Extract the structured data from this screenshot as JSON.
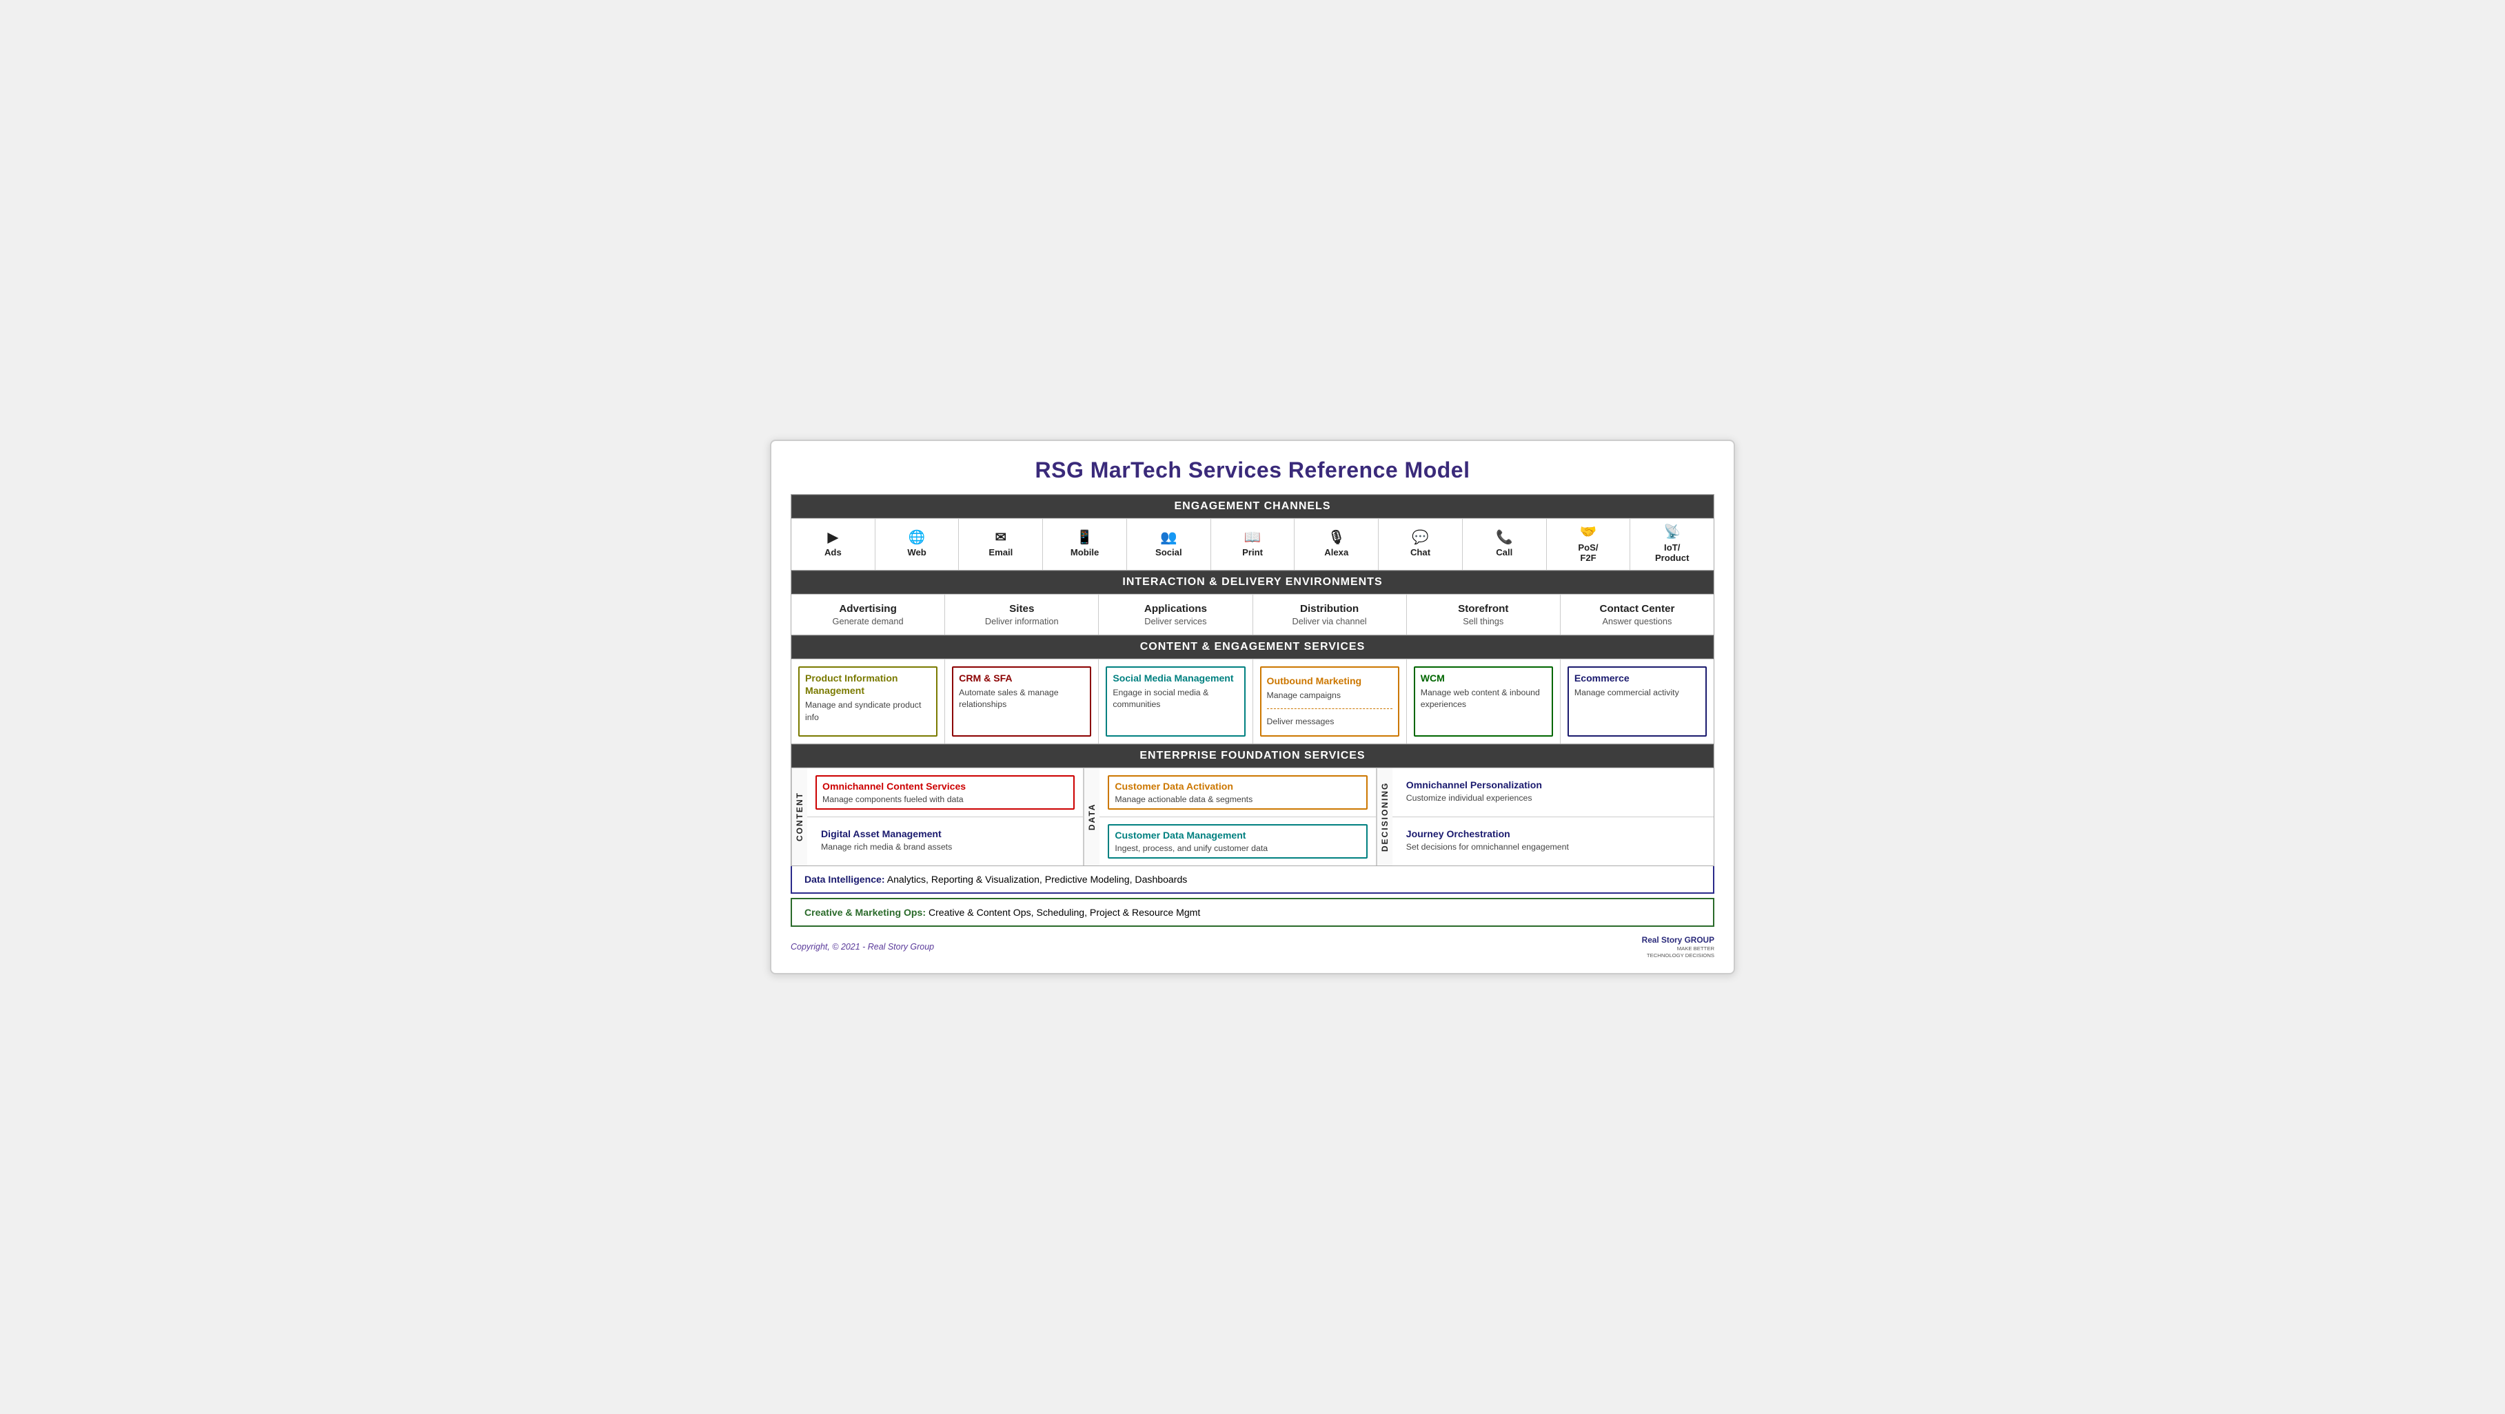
{
  "title": "RSG MarTech Services Reference Model",
  "sections": {
    "engagement_channels": {
      "header": "ENGAGEMENT CHANNELS",
      "channels": [
        {
          "icon": "▶",
          "label": "Ads"
        },
        {
          "icon": "🌐",
          "label": "Web"
        },
        {
          "icon": "✉",
          "label": "Email"
        },
        {
          "icon": "📱",
          "label": "Mobile"
        },
        {
          "icon": "👥",
          "label": "Social"
        },
        {
          "icon": "📖",
          "label": "Print"
        },
        {
          "icon": "🎙",
          "label": "Alexa"
        },
        {
          "icon": "💬",
          "label": "Chat"
        },
        {
          "icon": "📞",
          "label": "Call"
        },
        {
          "icon": "🤝",
          "label": "PoS/\nF2F"
        },
        {
          "icon": "📡",
          "label": "IoT/\nProduct"
        }
      ]
    },
    "interaction_delivery": {
      "header": "INTERACTION & DELIVERY ENVIRONMENTS",
      "cells": [
        {
          "title": "Advertising",
          "sub": "Generate demand"
        },
        {
          "title": "Sites",
          "sub": "Deliver information"
        },
        {
          "title": "Applications",
          "sub": "Deliver services"
        },
        {
          "title": "Distribution",
          "sub": "Deliver via channel"
        },
        {
          "title": "Storefront",
          "sub": "Sell things"
        },
        {
          "title": "Contact Center",
          "sub": "Answer questions"
        }
      ]
    },
    "content_engagement": {
      "header": "CONTENT & ENGAGEMENT SERVICES",
      "cells": [
        {
          "title": "Product Information Management",
          "sub": "Manage and syndicate product info",
          "color": "olive"
        },
        {
          "title": "CRM & SFA",
          "sub": "Automate sales & manage relationships",
          "color": "darkred"
        },
        {
          "title": "Social Media Management",
          "sub": "Engage in social media & communities",
          "color": "teal"
        },
        {
          "title": "Outbound Marketing",
          "sub_top": "Manage campaigns",
          "sub_bottom": "Deliver messages",
          "color": "orange",
          "split": true
        },
        {
          "title": "WCM",
          "sub": "Manage web content & inbound experiences",
          "color": "green"
        },
        {
          "title": "Ecommerce",
          "sub": "Manage commercial activity",
          "color": "navy"
        }
      ]
    },
    "enterprise_foundation": {
      "header": "ENTERPRISE FOUNDATION SERVICES",
      "content_label": "CONTENT",
      "data_label": "DATA",
      "decisioning_label": "DECISIONING",
      "content_cells": [
        {
          "title": "Omnichannel Content Services",
          "sub": "Manage components fueled with data",
          "color_class": "red",
          "title_color": "#cc0000"
        },
        {
          "title": "Digital Asset Management",
          "sub": "Manage rich media & brand assets",
          "color_class": "navy",
          "title_color": "#1a1a6e"
        }
      ],
      "data_cells": [
        {
          "title": "Customer Data Activation",
          "sub": "Manage actionable data & segments",
          "color_class": "orange",
          "title_color": "#cc7700"
        },
        {
          "title": "Customer Data Management",
          "sub": "Ingest, process, and unify customer data",
          "color_class": "teal",
          "title_color": "#008080"
        }
      ],
      "decisioning_cells": [
        {
          "title": "Omnichannel Personalization",
          "sub": "Customize individual experiences",
          "title_color": "#1a1a6e"
        },
        {
          "title": "Journey Orchestration",
          "sub": "Set decisions for omnichannel engagement",
          "title_color": "#1a1a6e"
        }
      ]
    },
    "data_intelligence": {
      "label_bold": "Data Intelligence:",
      "label_rest": " Analytics, Reporting & Visualization, Predictive Modeling, Dashboards"
    },
    "creative_marketing": {
      "label_bold": "Creative & Marketing Ops:",
      "label_rest": " Creative & Content Ops, Scheduling, Project & Resource Mgmt"
    }
  },
  "footer": {
    "copyright": "Copyright, © 2021 - Real Story Group",
    "logo_line1": "Real Story",
    "logo_line2": "GROUP",
    "logo_sub": "MAKE BETTER\nTECHNOLOGY DECISIONS"
  }
}
